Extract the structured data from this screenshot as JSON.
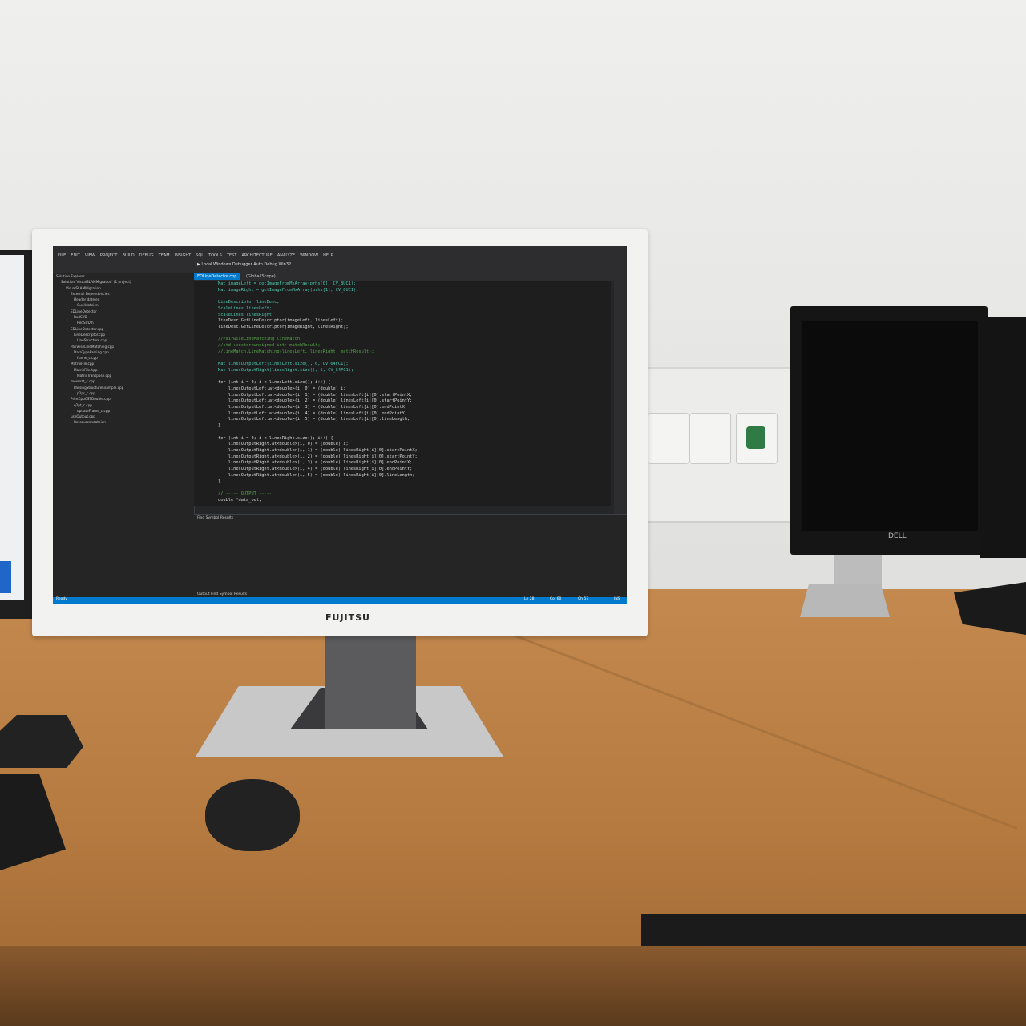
{
  "monitor": {
    "brand": "FUJITSU"
  },
  "dell": {
    "brand": "DELL"
  },
  "ide": {
    "menu": [
      "FILE",
      "EDIT",
      "VIEW",
      "PROJECT",
      "BUILD",
      "DEBUG",
      "TEAM",
      "INSIGHT",
      "SQL",
      "TOOLS",
      "TEST",
      "ARCHITECTURE",
      "ANALYZE",
      "WINDOW",
      "HELP"
    ],
    "toolbar": "▶ Local Windows Debugger   Auto        Debug        Win32",
    "active_tab": "EDLineDetector.cpp",
    "scope": "(Global Scope)",
    "solution_items": [
      "Solution Explorer",
      "Solution 'VisualSLAMMigration' (1 project)",
      "VisualSLAMMigration",
      "External Dependencies",
      "Header dateien",
      "Quelldateien",
      "EDLineDetector",
      "RedSVD",
      "RedSVD.h",
      "EDLineDetector.cpp",
      "LineDescriptor.cpp",
      "LineStructure.cpp",
      "PairwiseLineMatching.cpp",
      "DataTypeParsing.cpp",
      "frame_c.cpp",
      "MatrixFile.cpp",
      "MatrixFile.hpp",
      "MatrixTranspose.cpp",
      "mexmat_c.cpp",
      "PassingStructureExample.cpp",
      "p2pr_c.cpp",
      "PrintCppCSTDouble.cpp",
      "q2pt_c.cpp",
      "updateFrame_c.cpp",
      "useOutput.cpp",
      "Ressourcendateien"
    ],
    "code_lines": [
      "Mat imageLeft = getImageFromMxArray(prhs[0], CV_8UC1);",
      "Mat imageRight = getImageFromMxArray(prhs[1], CV_8UC1);",
      "",
      "LineDescriptor lineDesc;",
      "ScaleLines linesLeft;",
      "ScaleLines linesRight;",
      "lineDesc.GetLineDescriptor(imageLeft, linesLeft);",
      "lineDesc.GetLineDescriptor(imageRight, linesRight);",
      "",
      "//PairwiseLineMatching lineMatch;",
      "//std::vector<unsigned int> matchResult;",
      "//lineMatch.LineMatching(linesLeft, linesRight, matchResult);",
      "",
      "Mat linesOutputLeft(linesLeft.size(), 6, CV_64FC1);",
      "Mat linesOutputRight(linesRight.size(), 6, CV_64FC1);",
      "",
      "for (int i = 0; i < linesLeft.size(); i++) {",
      "    linesOutputLeft.at<double>(i, 0) = (double) i;",
      "    linesOutputLeft.at<double>(i, 1) = (double) linesLeft[i][0].startPointX;",
      "    linesOutputLeft.at<double>(i, 2) = (double) linesLeft[i][0].startPointY;",
      "    linesOutputLeft.at<double>(i, 3) = (double) linesLeft[i][0].endPointX;",
      "    linesOutputLeft.at<double>(i, 4) = (double) linesLeft[i][0].endPointY;",
      "    linesOutputLeft.at<double>(i, 5) = (double) linesLeft[i][0].lineLength;",
      "}",
      "",
      "for (int i = 0; i < linesRight.size(); i++) {",
      "    linesOutputRight.at<double>(i, 0) = (double) i;",
      "    linesOutputRight.at<double>(i, 1) = (double) linesRight[i][0].startPointX;",
      "    linesOutputRight.at<double>(i, 2) = (double) linesRight[i][0].startPointY;",
      "    linesOutputRight.at<double>(i, 3) = (double) linesRight[i][0].endPointX;",
      "    linesOutputRight.at<double>(i, 4) = (double) linesRight[i][0].endPointY;",
      "    linesOutputRight.at<double>(i, 5) = (double) linesRight[i][0].lineLength;",
      "}",
      "",
      "// ----- OUTPUT -----",
      "double *data_out;"
    ],
    "find_panel_title": "Find Symbol Results",
    "bottom_tabs": "Output   Find Symbol Results",
    "status": {
      "left": "Ready",
      "ln": "Ln 28",
      "col": "Col 60",
      "ch": "Ch 57",
      "mode": "INS"
    }
  }
}
